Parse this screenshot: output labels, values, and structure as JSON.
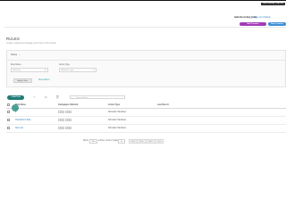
{
  "header": {
    "user_badge": "Hello Stanley | Sign out",
    "user_name": "Hello Recording (test)",
    "user_link": "Sign out of Admin",
    "primary_pill": "Add Creative",
    "secondary_pill": "New Creative"
  },
  "page": {
    "title": "RULES",
    "subtitle": "Create, enable and manage your rules in this section"
  },
  "filters": {
    "heading": "Filters",
    "rule_name_label": "Rule Name",
    "rule_name_value": "All Rules",
    "action_type_label": "Action Type",
    "action_type_value": "All Action Type",
    "apply_label": "Apply Filters",
    "clear_label": "Clear Filters"
  },
  "toolbar": {
    "add_label": "+ Add Rule",
    "search_placeholder": "Search Rules"
  },
  "table": {
    "columns": [
      "Rule Name",
      "Campaigns Affected",
      "Action Type",
      "Last Run At"
    ],
    "rows": [
      {
        "name": "a",
        "campaigns": [
          "1 ▾",
          "1 ▾"
        ],
        "action": "Schedule Handover",
        "last_run": ""
      },
      {
        "name": "Thanksform Rule",
        "campaigns": [
          "1 ▾",
          "1 ▾"
        ],
        "action": "Schedule Handover",
        "last_run": ""
      },
      {
        "name": "New rule",
        "campaigns": [
          "1 ▾",
          "1 ▾"
        ],
        "action": "Schedule Handover",
        "last_run": ""
      }
    ]
  },
  "pager": {
    "show_label": "Show",
    "per_page": "10 ▾",
    "entries_label": "entries, Jump to page",
    "page_value": "1 ▾",
    "first": "First",
    "prev": "Prev",
    "next": "Next",
    "last": "Last"
  },
  "colors": {
    "accent_teal": "#1f7b76",
    "pill_purple": "#a23bb7",
    "pill_blue": "#3e8fd6",
    "link_blue": "#2a7ab8"
  }
}
